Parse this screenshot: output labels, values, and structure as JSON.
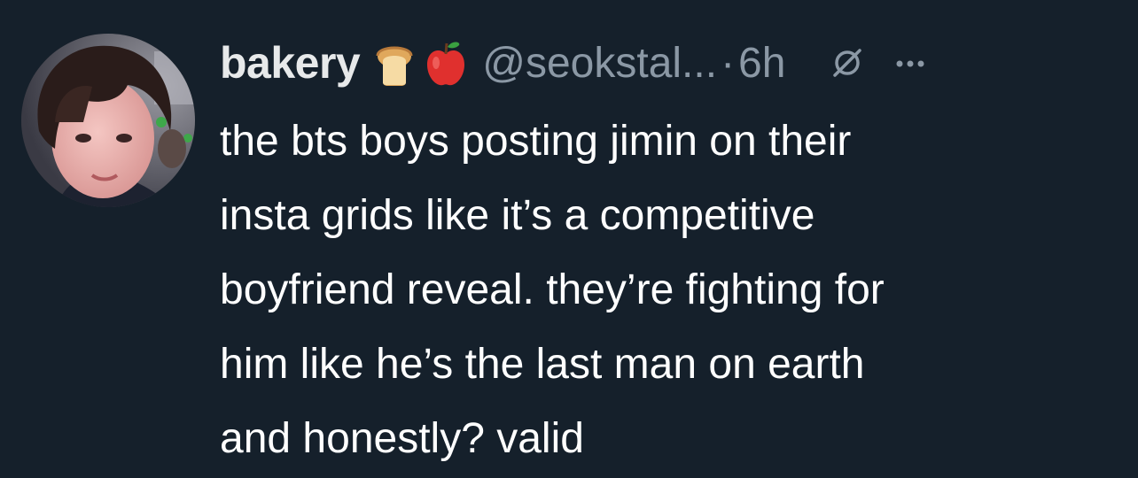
{
  "tweet": {
    "display_name": "bakery",
    "emojis": [
      "bread-icon",
      "apple-icon"
    ],
    "handle": "@seokstal...",
    "separator": "·",
    "time": "6h",
    "icons": {
      "grok": "grok-icon",
      "more": "more-options-icon"
    },
    "text_lines": [
      "the bts boys posting jimin on their",
      "insta grids like it’s a competitive",
      "boyfriend reveal. they’re fighting for",
      "him like he’s the last man on earth",
      "and honestly? valid"
    ]
  },
  "colors": {
    "background": "#15202b",
    "primary_text": "#ffffff",
    "secondary_text": "#8b98a5"
  }
}
